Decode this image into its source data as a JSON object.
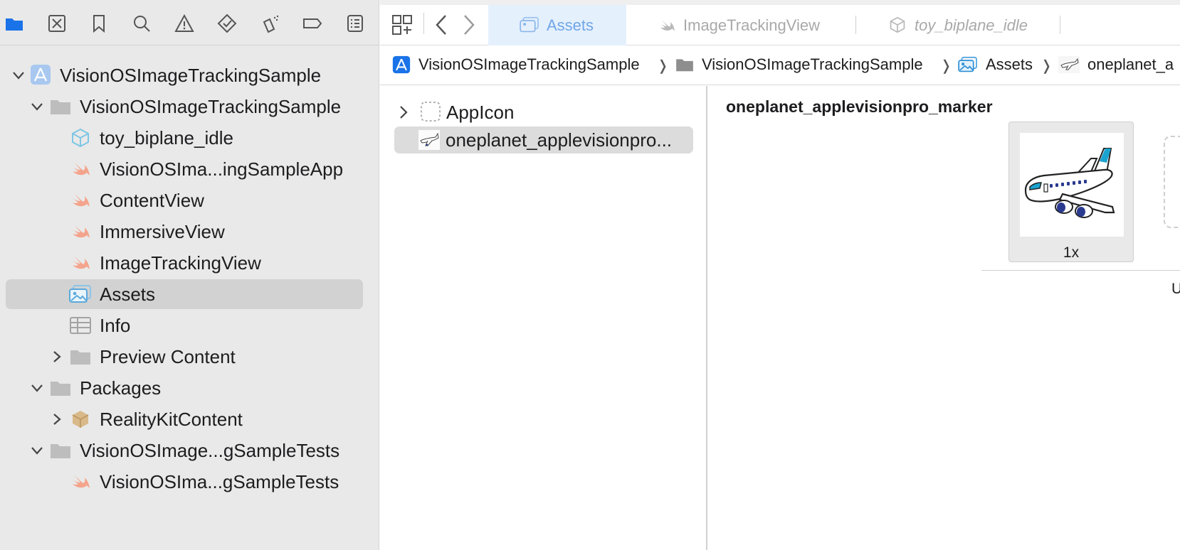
{
  "navigator": {
    "toolbar_icons": [
      "folder-icon",
      "source-control-icon",
      "bookmark-icon",
      "find-icon",
      "issue-icon",
      "test-icon",
      "debug-icon",
      "breakpoint-icon",
      "report-icon"
    ],
    "accent_color": "#1a73e8",
    "tree": [
      {
        "label": "VisionOSImageTrackingSample",
        "icon": "app-project-icon"
      },
      {
        "label": "VisionOSImageTrackingSample",
        "icon": "folder-icon"
      },
      {
        "label": "toy_biplane_idle",
        "icon": "3d-model-icon"
      },
      {
        "label": "VisionOSIma...ingSampleApp",
        "icon": "swift-icon"
      },
      {
        "label": "ContentView",
        "icon": "swift-icon"
      },
      {
        "label": "ImmersiveView",
        "icon": "swift-icon"
      },
      {
        "label": "ImageTrackingView",
        "icon": "swift-icon"
      },
      {
        "label": "Assets",
        "icon": "asset-catalog-icon"
      },
      {
        "label": "Info",
        "icon": "plist-icon"
      },
      {
        "label": "Preview Content",
        "icon": "folder-icon"
      },
      {
        "label": "Packages",
        "icon": "folder-icon"
      },
      {
        "label": "RealityKitContent",
        "icon": "package-icon"
      },
      {
        "label": "VisionOSImage...gSampleTests",
        "icon": "folder-icon"
      },
      {
        "label": "VisionOSIma...gSampleTests",
        "icon": "swift-icon"
      }
    ]
  },
  "editor": {
    "tabs": [
      {
        "label": "Assets",
        "icon": "asset-catalog-icon"
      },
      {
        "label": "ImageTrackingView",
        "icon": "swift-icon"
      },
      {
        "label": "toy_biplane_idle",
        "icon": "3d-model-icon"
      }
    ],
    "breadcrumb": [
      "VisionOSImageTrackingSample",
      "VisionOSImageTrackingSample",
      "Assets",
      "oneplanet_a"
    ],
    "asset_list": [
      {
        "label": "AppIcon"
      },
      {
        "label": "oneplanet_applevisionpro..."
      }
    ],
    "detail": {
      "title": "oneplanet_applevisionpro_marker",
      "slot_label": "1x",
      "truncated_text": "U"
    }
  }
}
